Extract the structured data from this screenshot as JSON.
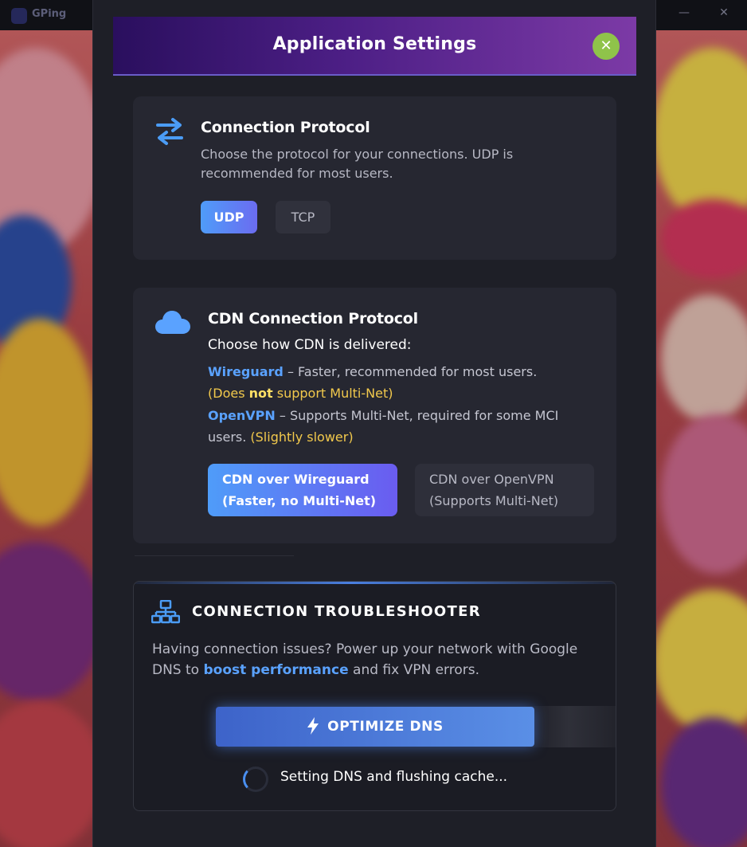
{
  "background_app": {
    "name": "GPing",
    "window_controls": [
      "—",
      "✕"
    ]
  },
  "modal": {
    "title": "Application Settings",
    "close_icon": "✕",
    "colors": {
      "header_gradient_start": "#2a0f5e",
      "header_gradient_end": "#7c3aa6",
      "close_button": "#8fc34a",
      "accent_blue": "#5aa2ff",
      "highlight_yellow": "#f2c94c"
    }
  },
  "connection_protocol": {
    "icon": "swap-arrows-icon",
    "title": "Connection Protocol",
    "description": "Choose the protocol for your connections. UDP is recommended for most users.",
    "options": [
      {
        "label": "UDP",
        "selected": true
      },
      {
        "label": "TCP",
        "selected": false
      }
    ]
  },
  "cdn_protocol": {
    "icon": "cloud-icon",
    "title": "CDN Connection Protocol",
    "intro": "Choose how CDN is delivered:",
    "wireguard": {
      "name": "Wireguard",
      "text": " – Faster, recommended for most users.",
      "note_open": "(Does ",
      "note_strong": "not",
      "note_close": " support Multi-Net)"
    },
    "openvpn": {
      "name": "OpenVPN",
      "text": " – Supports Multi-Net, required for some MCI",
      "text_line2": "users. ",
      "note": "(Slightly slower)"
    },
    "options": [
      {
        "line1": "CDN over Wireguard",
        "line2": "(Faster, no Multi-Net)",
        "selected": true
      },
      {
        "line1": "CDN over OpenVPN",
        "line2": "(Supports Multi-Net)",
        "selected": false
      }
    ]
  },
  "troubleshooter": {
    "icon": "network-icon",
    "title": "CONNECTION TROUBLESHOOTER",
    "desc_before": "Having connection issues? Power up your network with Google DNS to ",
    "desc_link": "boost performance",
    "desc_after": " and fix VPN errors.",
    "button_label": "OPTIMIZE DNS",
    "button_icon": "lightning-icon",
    "status": "Setting DNS and flushing cache..."
  }
}
